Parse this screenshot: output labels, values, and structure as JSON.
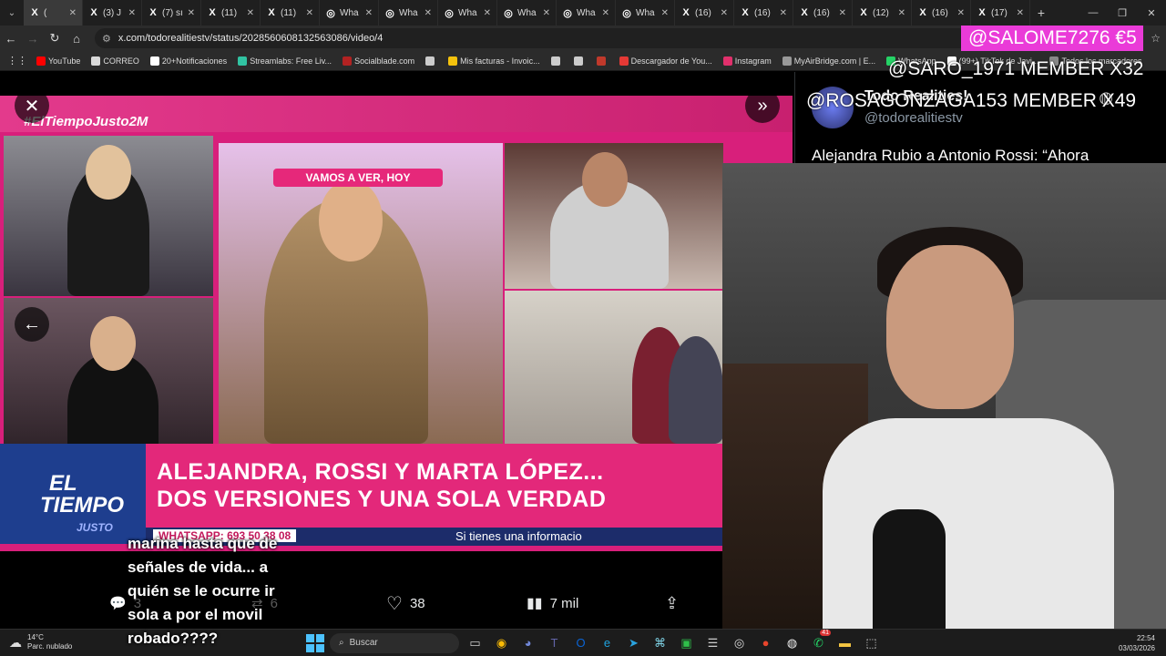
{
  "browser": {
    "tabs": [
      {
        "icon": "X",
        "label": "(",
        "active": true
      },
      {
        "icon": "X",
        "label": "(3) J"
      },
      {
        "icon": "X",
        "label": "(7) sı"
      },
      {
        "icon": "X",
        "label": "(11)"
      },
      {
        "icon": "X",
        "label": "(11)"
      },
      {
        "icon": "◎",
        "label": "Wha"
      },
      {
        "icon": "◎",
        "label": "Wha"
      },
      {
        "icon": "◎",
        "label": "Wha"
      },
      {
        "icon": "◎",
        "label": "Wha"
      },
      {
        "icon": "◎",
        "label": "Wha"
      },
      {
        "icon": "◎",
        "label": "Wha"
      },
      {
        "icon": "X",
        "label": "(16)"
      },
      {
        "icon": "X",
        "label": "(16)"
      },
      {
        "icon": "X",
        "label": "(16)"
      },
      {
        "icon": "X",
        "label": "(12)"
      },
      {
        "icon": "X",
        "label": "(16)"
      },
      {
        "icon": "X",
        "label": "(17)"
      }
    ],
    "url": "x.com/todorealitiestv/status/2028560608132563086/video/4",
    "bookmarks": [
      {
        "label": "YouTube",
        "color": "#ff0000"
      },
      {
        "label": "CORREO",
        "color": "#d9d9d9"
      },
      {
        "label": "20+Notificaciones",
        "color": "#ffffff"
      },
      {
        "label": "Streamlabs: Free Liv...",
        "color": "#31c3a2"
      },
      {
        "label": "Socialblade.com",
        "color": "#b22222"
      },
      {
        "label": "",
        "color": "#cccccc"
      },
      {
        "label": "Mis facturas - Invoic...",
        "color": "#f4c20d"
      },
      {
        "label": "",
        "color": "#cccccc"
      },
      {
        "label": "",
        "color": "#cccccc"
      },
      {
        "label": "",
        "color": "#c0392b"
      },
      {
        "label": "Descargador de You...",
        "color": "#e53935"
      },
      {
        "label": "Instagram",
        "color": "#e1306c"
      },
      {
        "label": "MyAirBridge.com | E...",
        "color": "#999999"
      },
      {
        "label": "WhatsApp",
        "color": "#25d366"
      },
      {
        "label": "(99+) TikTok de Javi...",
        "color": "#ffffff"
      },
      {
        "label": "Todos los marcadores",
        "color": "#888888"
      }
    ]
  },
  "video": {
    "hashtag": "#ElTiempoJusto2M",
    "tag": "VAMOS A VER, HOY",
    "headline_1": "ALEJANDRA, ROSSI Y MARTA LÓPEZ...",
    "headline_2": "DOS VERSIONES Y UNA SOLA VERDAD",
    "logo_1": "EL",
    "logo_2": "TIEMPO",
    "logo_3": "JUSTO",
    "whatsapp": "WHATSAPP: 693 50 38 08",
    "ticker": "Si tienes una informacio"
  },
  "tweet": {
    "name": "Todo Realities!",
    "handle": "@todorealitiestv",
    "text": "Alejandra Rubio a Antonio Rossi: “Ahora",
    "replies": "3",
    "reposts": "6",
    "likes": "38",
    "views": "7 mil"
  },
  "overlays": {
    "donation": "@SALOME7276  €5",
    "member_1": "@SARO_1971  MEMBER X32",
    "member_2": "@ROSAGONZAGA153  MEMBER X49",
    "caption": "marina hasta que de señales de vida... a quién se le ocurre ir sola a por el movil robado????"
  },
  "taskbar": {
    "temp": "14°C",
    "weather": "Parc. nublado",
    "search": "Buscar",
    "time": "22:54",
    "date": "03/03/2026",
    "badge": "41"
  }
}
